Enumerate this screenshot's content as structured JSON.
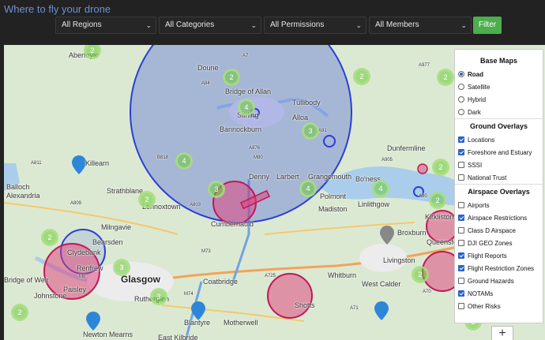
{
  "page_title": "Where to fly your drone",
  "filters": {
    "regions": "All Regions",
    "categories": "All Categories",
    "permissions": "All Permissions",
    "members": "All Members",
    "filter_label": "Filter"
  },
  "map": {
    "places": [
      "Aberfoyle",
      "Doune",
      "Bridge of Allan",
      "Tullibody",
      "Stirling",
      "Alloa",
      "Bannockburn",
      "Dunfermline",
      "Killearn",
      "Balloch",
      "Alexandria",
      "Strathblane",
      "Denny",
      "Larbert",
      "Grangemouth",
      "Bo'ness",
      "Lennoxtown",
      "Polmont",
      "Madiston",
      "Linlithgow",
      "Kirkliston",
      "Milngavie",
      "Cumbernauld",
      "Bearsden",
      "Broxburn",
      "Queensferry",
      "Clydebank",
      "Renfrew",
      "Glasgow",
      "Coatbridge",
      "Livingston",
      "Bridge of Weir",
      "Paisley",
      "Johnstone",
      "Rutherglen",
      "Whitburn",
      "West Calder",
      "Shotts",
      "Blantyre",
      "Motherwell",
      "Newton Mearns",
      "East Kilbride"
    ],
    "road_labels": [
      "A7",
      "A84",
      "A91",
      "A876",
      "A811",
      "A803",
      "M73",
      "M8",
      "M80",
      "B818",
      "A809",
      "A905",
      "A71",
      "A90",
      "A70",
      "M74",
      "A725",
      "A977"
    ],
    "clusters": [
      "2",
      "2",
      "2",
      "4",
      "4",
      "3",
      "4",
      "3",
      "2",
      "3",
      "4",
      "2",
      "2",
      "3",
      "2",
      "2",
      "2",
      "2",
      "2"
    ],
    "zoom_in": "+"
  },
  "layers": {
    "base_maps_title": "Base Maps",
    "base_maps": [
      {
        "label": "Road",
        "selected": true
      },
      {
        "label": "Satellite",
        "selected": false
      },
      {
        "label": "Hybrid",
        "selected": false
      },
      {
        "label": "Dark",
        "selected": false
      }
    ],
    "ground_title": "Ground Overlays",
    "ground": [
      {
        "label": "Locations",
        "checked": true
      },
      {
        "label": "Foreshore and Estuary",
        "checked": true
      },
      {
        "label": "SSSI",
        "checked": false
      },
      {
        "label": "National Trust",
        "checked": false
      }
    ],
    "airspace_title": "Airspace Overlays",
    "airspace": [
      {
        "label": "Airports",
        "checked": false
      },
      {
        "label": "Airspace Restrictions",
        "checked": true
      },
      {
        "label": "Class D Airspace",
        "checked": false
      },
      {
        "label": "DJI GEO Zones",
        "checked": false
      },
      {
        "label": "Flight Reports",
        "checked": true
      },
      {
        "label": "Flight Restriction Zones",
        "checked": true
      },
      {
        "label": "Ground Hazards",
        "checked": false
      },
      {
        "label": "NOTAMs",
        "checked": true
      },
      {
        "label": "Other Risks",
        "checked": false
      }
    ]
  },
  "colors": {
    "restriction_blue": "#2b3fd6",
    "flight_red": "#c0185a",
    "cluster_green": "#6ecc39",
    "filter_green": "#4cae4c"
  }
}
